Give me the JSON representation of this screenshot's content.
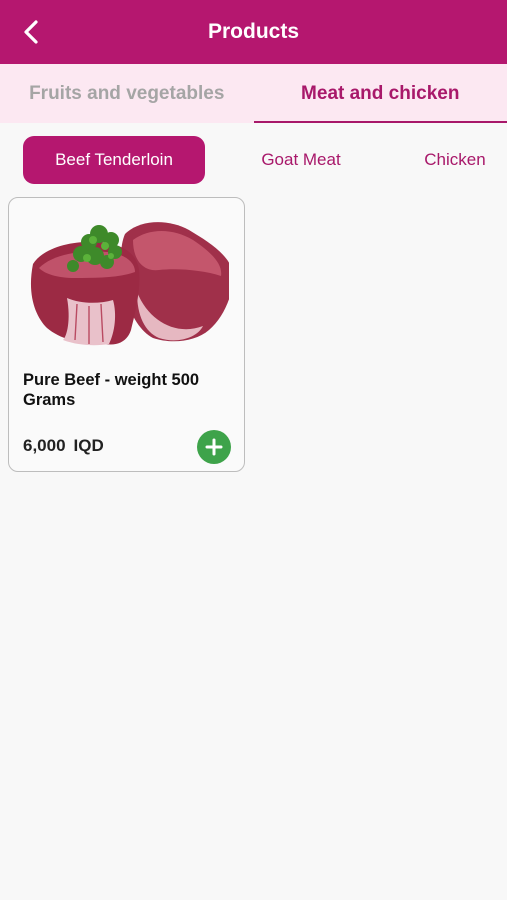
{
  "header": {
    "title": "Products",
    "back_icon": "chevron-left-icon"
  },
  "tabs": [
    {
      "label": "Fruits and vegetables",
      "active": false
    },
    {
      "label": "Meat and chicken",
      "active": true
    }
  ],
  "subcategories": [
    {
      "label": "Beef Tenderloin",
      "active": true
    },
    {
      "label": "Goat Meat",
      "active": false
    },
    {
      "label": "Chicken",
      "active": false
    }
  ],
  "products": [
    {
      "name": "Pure Beef - weight 500 Grams",
      "price": "6,000",
      "currency": "IQD",
      "image": "beef-tenderloin-image",
      "add_icon": "plus-icon"
    }
  ],
  "colors": {
    "primary": "#b5176f",
    "tab_bar_bg": "#fce8f2",
    "accent_text": "#a8186a",
    "add_button": "#3ea34a",
    "background": "#f8f8f8"
  }
}
